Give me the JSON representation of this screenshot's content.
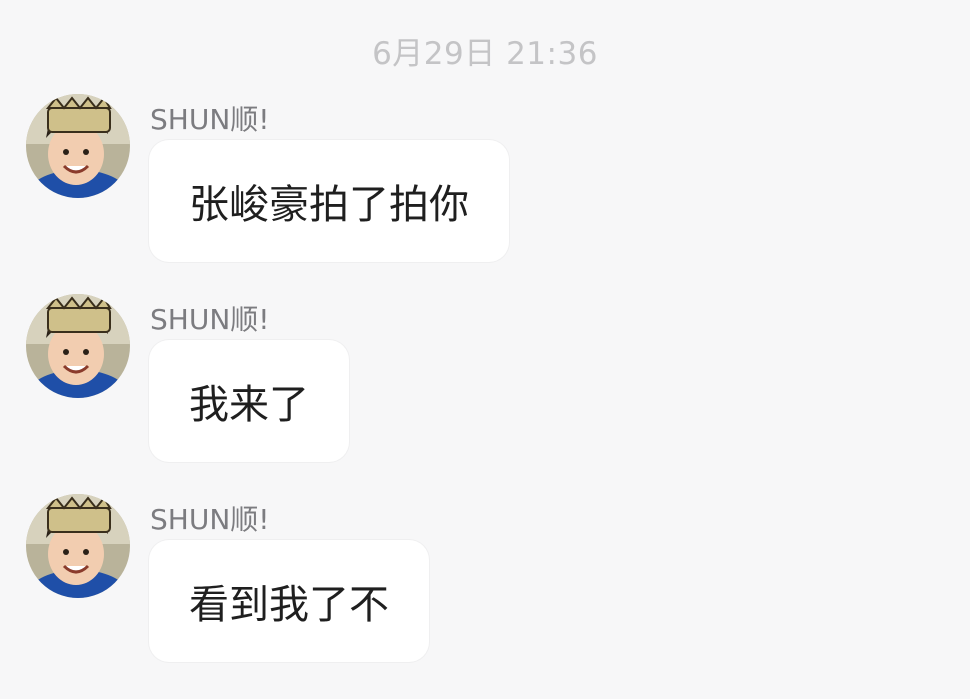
{
  "chat": {
    "timestamp": "6月29日 21:36",
    "messages": [
      {
        "sender": "SHUN顺!",
        "text": "张峻豪拍了拍你"
      },
      {
        "sender": "SHUN顺!",
        "text": "我来了"
      },
      {
        "sender": "SHUN顺!",
        "text": "看到我了不"
      }
    ]
  },
  "colors": {
    "background": "#f7f7f8",
    "bubble": "#ffffff",
    "timestamp": "#c4c4c6",
    "sender": "#7c7c80",
    "message_text": "#1f1f1f"
  }
}
